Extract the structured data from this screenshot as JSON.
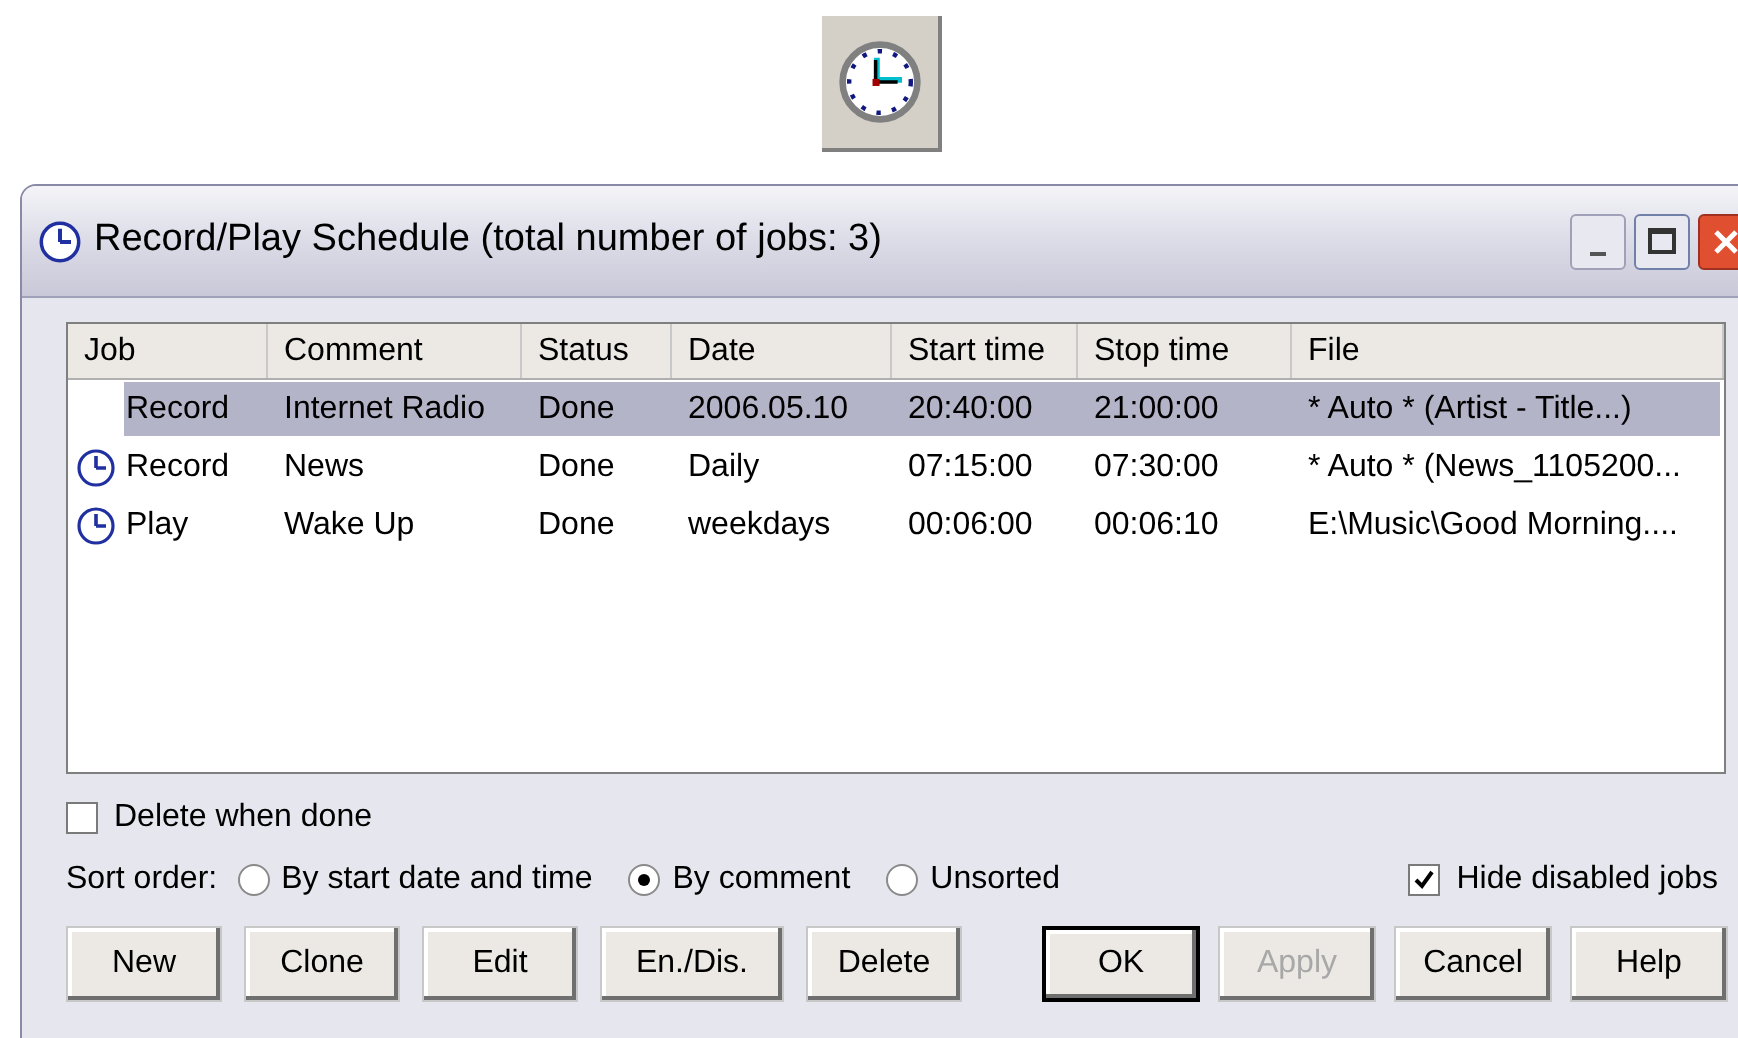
{
  "window": {
    "title": "Record/Play Schedule (total number of jobs: 3)"
  },
  "table": {
    "columns": [
      "Job",
      "Comment",
      "Status",
      "Date",
      "Start time",
      "Stop time",
      "File"
    ],
    "rows": [
      {
        "selected": true,
        "enabled": false,
        "cells": [
          "Record",
          "Internet Radio",
          "Done",
          "2006.05.10",
          "20:40:00",
          "21:00:00",
          "* Auto * (Artist - Title...)"
        ]
      },
      {
        "selected": false,
        "enabled": true,
        "cells": [
          "Record",
          "News",
          "Done",
          "Daily",
          "07:15:00",
          "07:30:00",
          "* Auto * (News_1105200..."
        ]
      },
      {
        "selected": false,
        "enabled": true,
        "cells": [
          "Play",
          "Wake Up",
          "Done",
          "weekdays",
          "00:06:00",
          "00:06:10",
          "E:\\Music\\Good Morning...."
        ]
      }
    ]
  },
  "delete_when_done": {
    "label": "Delete when done",
    "checked": false
  },
  "sort_order": {
    "label": "Sort order:",
    "options": [
      {
        "label": "By start date and time",
        "selected": false
      },
      {
        "label": "By comment",
        "selected": true
      },
      {
        "label": "Unsorted",
        "selected": false
      }
    ]
  },
  "hide_disabled": {
    "label": "Hide disabled jobs",
    "checked": true
  },
  "buttons_left": [
    {
      "label": "New",
      "disabled": false
    },
    {
      "label": "Clone",
      "disabled": false
    },
    {
      "label": "Edit",
      "disabled": false
    },
    {
      "label": "En./Dis.",
      "disabled": false
    },
    {
      "label": "Delete",
      "disabled": false
    }
  ],
  "buttons_right": [
    {
      "label": "OK",
      "disabled": false,
      "default": true
    },
    {
      "label": "Apply",
      "disabled": true,
      "default": false
    },
    {
      "label": "Cancel",
      "disabled": false,
      "default": false
    },
    {
      "label": "Help",
      "disabled": false,
      "default": false
    }
  ]
}
